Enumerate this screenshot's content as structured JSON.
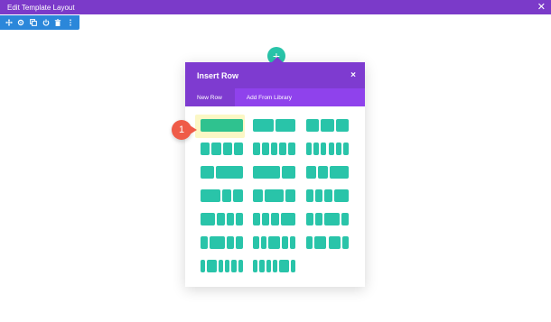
{
  "window": {
    "title": "Edit Template Layout",
    "close_icon": "close-icon"
  },
  "toolbar": {
    "icons": [
      "move-icon",
      "gear-icon",
      "duplicate-icon",
      "power-icon",
      "trash-icon",
      "more-icon"
    ]
  },
  "add_button": {
    "label": "+",
    "icon": "plus-icon"
  },
  "modal": {
    "title": "Insert Row",
    "close_label": "×",
    "tabs": [
      {
        "label": "New Row",
        "active": true
      },
      {
        "label": "Add From Library",
        "active": false
      }
    ],
    "accent": "#7e3bd0",
    "column_color": "#29c4a9",
    "layouts": [
      [
        [
          1
        ],
        [
          1,
          1
        ],
        [
          1,
          1,
          1
        ]
      ],
      [
        [
          1,
          1,
          1,
          1
        ],
        [
          1,
          1,
          1,
          1,
          1
        ],
        [
          1,
          1,
          1,
          1,
          1,
          1
        ]
      ],
      [
        [
          1,
          2
        ],
        [
          2,
          1
        ],
        [
          1,
          1,
          2
        ]
      ],
      [
        [
          2,
          1,
          1
        ],
        [
          1,
          2,
          1
        ],
        [
          1,
          1,
          1,
          2
        ]
      ],
      [
        [
          2,
          1,
          1,
          1
        ],
        [
          1,
          1,
          1,
          2
        ],
        [
          1,
          1,
          2,
          1
        ]
      ],
      [
        [
          1,
          2,
          1,
          1
        ],
        [
          1,
          1,
          2,
          1,
          1
        ],
        [
          1,
          2,
          2,
          1
        ]
      ],
      [
        [
          1,
          2,
          1,
          1,
          1,
          1
        ],
        [
          1,
          1,
          1,
          1,
          2,
          1
        ],
        null
      ]
    ]
  },
  "step_badge": {
    "label": "1"
  }
}
